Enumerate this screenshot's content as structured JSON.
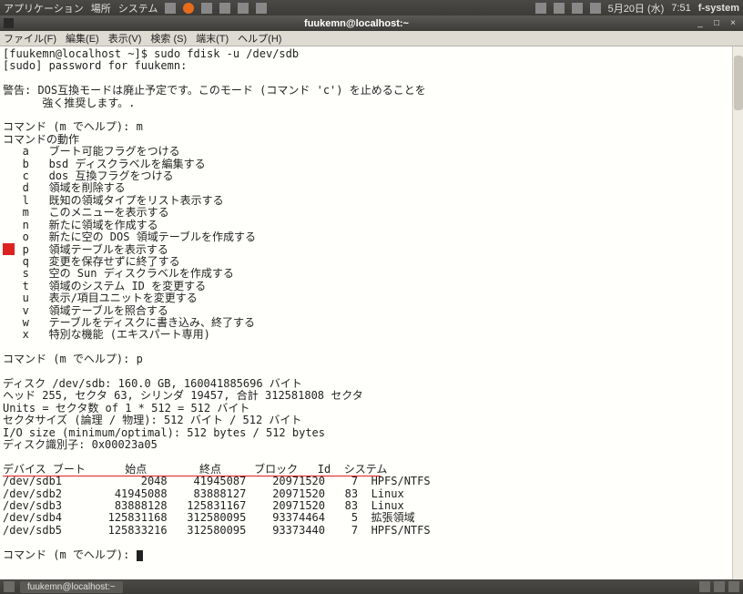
{
  "top_panel": {
    "apps": "アプリケーション",
    "places": "場所",
    "system": "システム",
    "date": "5月20日 (水)",
    "time": "7:51",
    "user": "f-system"
  },
  "window": {
    "title": "fuukemn@localhost:~"
  },
  "menubar": {
    "file": "ファイル(F)",
    "edit": "編集(E)",
    "view": "表示(V)",
    "search": "検索 (S)",
    "terminal": "端末(T)",
    "help": "ヘルプ(H)"
  },
  "term": {
    "line1": "[fuukemn@localhost ~]$ sudo fdisk -u /dev/sdb",
    "line2": "[sudo] password for fuukemn:",
    "warn1": "警告: DOS互換モードは廃止予定です。このモード (コマンド 'c') を止めることを",
    "warn2": "      強く推奨します。.",
    "cmd_m": "コマンド (m でヘルプ): m",
    "cmd_hdr": "コマンドの動作",
    "a": "   a   ブート可能フラグをつける",
    "b": "   b   bsd ディスクラベルを編集する",
    "c": "   c   dos 互換フラグをつける",
    "d": "   d   領域を削除する",
    "l": "   l   既知の領域タイプをリスト表示する",
    "m": "   m   このメニューを表示する",
    "n": "   n   新たに領域を作成する",
    "o": "   o   新たに空の DOS 領域テーブルを作成する",
    "p": "   p   領域テーブルを表示する",
    "q": "   q   変更を保存せずに終了する",
    "s": "   s   空の Sun ディスクラベルを作成する",
    "t": "   t   領域のシステム ID を変更する",
    "u": "   u   表示/項目ユニットを変更する",
    "v": "   v   領域テーブルを照合する",
    "w": "   w   テーブルをディスクに書き込み、終了する",
    "x": "   x   特別な機能 (エキスパート専用)",
    "cmd_p": "コマンド (m でヘルプ): p",
    "disk1": "ディスク /dev/sdb: 160.0 GB, 160041885696 バイト",
    "disk2": "ヘッド 255, セクタ 63, シリンダ 19457, 合計 312581808 セクタ",
    "disk3": "Units = セクタ数 of 1 * 512 = 512 バイト",
    "disk4": "セクタサイズ (論理 / 物理): 512 バイト / 512 バイト",
    "disk5": "I/O size (minimum/optimal): 512 bytes / 512 bytes",
    "disk6": "ディスク識別子: 0x00023a05",
    "thead": "デバイス ブート      始点        終点     ブロック   Id  システム",
    "r1": "/dev/sdb1            2048    41945087    20971520    7  HPFS/NTFS",
    "r2": "/dev/sdb2        41945088    83888127    20971520   83  Linux",
    "r3": "/dev/sdb3        83888128   125831167    20971520   83  Linux",
    "r4": "/dev/sdb4       125831168   312580095    93374464    5  拡張領域",
    "r5": "/dev/sdb5       125833216   312580095    93373440    7  HPFS/NTFS",
    "prompt": "コマンド (m でヘルプ): "
  },
  "bottom": {
    "task": "fuukemn@localhost:~"
  },
  "chart_data": {
    "type": "table",
    "title": "fdisk partition table for /dev/sdb",
    "columns": [
      "デバイス",
      "ブート",
      "始点",
      "終点",
      "ブロック",
      "Id",
      "システム"
    ],
    "rows": [
      [
        "/dev/sdb1",
        "",
        2048,
        41945087,
        20971520,
        7,
        "HPFS/NTFS"
      ],
      [
        "/dev/sdb2",
        "",
        41945088,
        83888127,
        20971520,
        83,
        "Linux"
      ],
      [
        "/dev/sdb3",
        "",
        83888128,
        125831167,
        20971520,
        83,
        "Linux"
      ],
      [
        "/dev/sdb4",
        "",
        125831168,
        312580095,
        93374464,
        5,
        "拡張領域"
      ],
      [
        "/dev/sdb5",
        "",
        125833216,
        312580095,
        93373440,
        7,
        "HPFS/NTFS"
      ]
    ]
  }
}
